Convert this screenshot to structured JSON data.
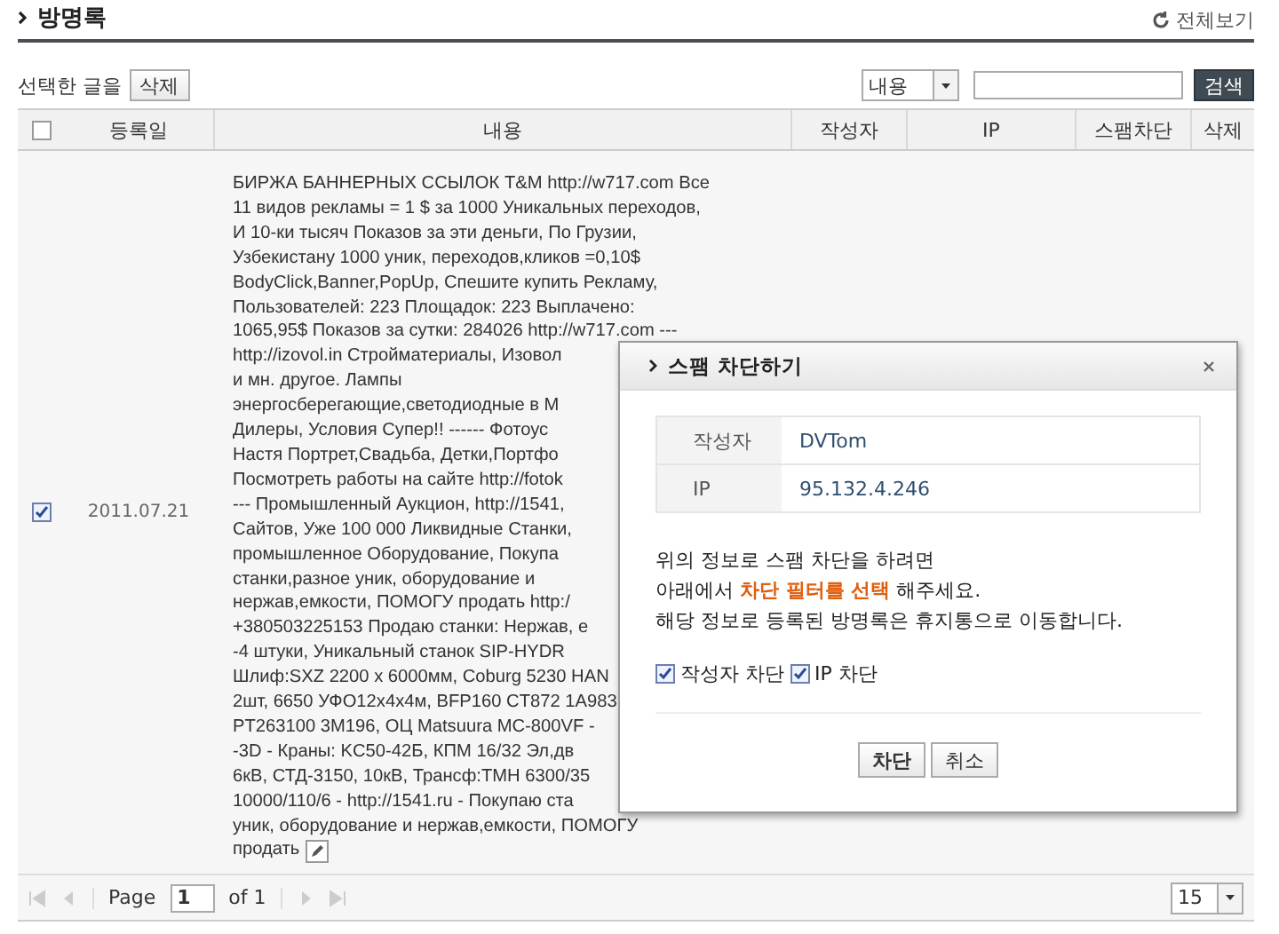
{
  "header": {
    "title": "방명록",
    "view_all": "전체보기"
  },
  "toolbar": {
    "selected_label": "선택한 글을",
    "delete_button": "삭제",
    "search_select": "내용",
    "search_button": "검색"
  },
  "table": {
    "select_all_checked": false,
    "columns": [
      "등록일",
      "내용",
      "작성자",
      "IP",
      "스팸차단",
      "삭제"
    ],
    "rows": [
      {
        "checked": true,
        "date": "2011.07.21",
        "content_lines": [
          "БИРЖА БАННЕРНЫХ ССЫЛОК T&M http://w717.com Все",
          "11 видов рекламы = 1 $ за 1000 Уникальных переходов,",
          "И 10-ки тысяч Показов за эти деньги, По Грузии,",
          "Узбекистану 1000 уник, переходов,кликов =0,10$",
          "BodyClick,Banner,PopUp, Спешите купить Рекламу,",
          "Пользователей: 223 Площадок: 223 Выплачено:",
          "1065,95$ Показов за сутки: 284026 http://w717.com ---",
          "http://izovol.in Стройматериалы, Изовол",
          "и мн. другое. Лампы",
          "энергосберегающие,светодиодные в М",
          "Дилеры, Условия Супер!! ------ Фотоус",
          "Настя Портрет,Свадьба, Детки,Портфо",
          "Посмотреть работы на сайте http://fotok",
          "--- Промышленный Аукцион, http://1541,",
          "Сайтов, Уже 100 000 Ликвидные Станки,",
          "промышленное Оборудование, Покупа",
          "станки,разное уник, оборудование и",
          "нержав,емкости, ПОМОГУ продать http:/",
          "+380503225153 Продаю станки: Нержав, е",
          "-4 штуки, Уникальный станок SIP-HYDR",
          "Шлиф:SXZ 2200 x 6000мм, Coburg 5230 HAN",
          "2шт, 6650 УФО12x4x4м, BFP160 CT872 1A983",
          "PT263100 3M196, ОЦ Matsuura MC-800VF -",
          "-3D - Краны: KC50-42Б, КПМ 16/32 Эл,дв",
          "6кВ, СТД-3150, 10кВ, Трансф:ТМН 6300/35",
          "10000/110/6 - http://1541.ru - Покупаю ста",
          "уник, оборудование и нержав,емкости, ПОМОГУ",
          "продать"
        ]
      }
    ]
  },
  "pager": {
    "page_label": "Page",
    "page": "1",
    "of": "of 1",
    "page_size": "15"
  },
  "dialog": {
    "title": "스팸 차단하기",
    "info": [
      {
        "label": "작성자",
        "value": "DVTom"
      },
      {
        "label": "IP",
        "value": "95.132.4.246"
      }
    ],
    "message_lines": [
      "위의 정보로 스팸 차단을 하려면",
      "아래에서 **차단 필터를 선택** 해주세요.",
      "해당 정보로 등록된 방명록은 휴지통으로 이동합니다."
    ],
    "options": [
      {
        "label": "작성자 차단",
        "checked": true
      },
      {
        "label": "IP 차단",
        "checked": true
      }
    ],
    "buttons": [
      {
        "label": "차단",
        "primary": true
      },
      {
        "label": "취소",
        "primary": false
      }
    ]
  }
}
